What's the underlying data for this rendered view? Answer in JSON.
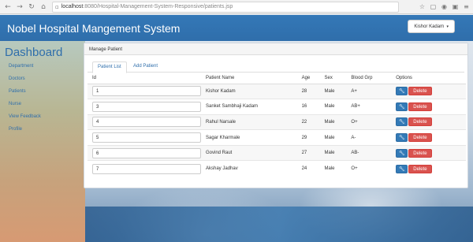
{
  "browser": {
    "url_host": "localhost",
    "url_path": ":8080/Hospital-Management-System-Responsive/patients.jsp"
  },
  "header": {
    "brand": "Nobel Hospital Mangement System",
    "user": "Kishor Kadam"
  },
  "sidebar": {
    "title": "Dashboard",
    "items": [
      {
        "label": "Department"
      },
      {
        "label": "Doctors"
      },
      {
        "label": "Patients"
      },
      {
        "label": "Nurse"
      },
      {
        "label": "View Feedback"
      },
      {
        "label": "Profile"
      }
    ]
  },
  "panel": {
    "heading": "Manage Patient",
    "tabs": [
      {
        "label": "Patient List",
        "active": true
      },
      {
        "label": "Add Patient",
        "active": false
      }
    ],
    "columns": [
      "Id",
      "Patient Name",
      "Age",
      "Sex",
      "Blood Grp",
      "Options"
    ],
    "rows": [
      {
        "id": "1",
        "name": "Kishor Kadam",
        "age": "28",
        "sex": "Male",
        "blood": "A+"
      },
      {
        "id": "3",
        "name": "Sanket Sambhaji Kadam",
        "age": "16",
        "sex": "Male",
        "blood": "AB+"
      },
      {
        "id": "4",
        "name": "Rahul Narsale",
        "age": "22",
        "sex": "Male",
        "blood": "O+"
      },
      {
        "id": "5",
        "name": "Sagar Kharmale",
        "age": "29",
        "sex": "Male",
        "blood": "A-"
      },
      {
        "id": "6",
        "name": "Govind Raut",
        "age": "27",
        "male": "",
        "sex": "Male",
        "blood": "AB-"
      },
      {
        "id": "7",
        "name": "Akshay Jadhav",
        "age": "24",
        "sex": "Male",
        "blood": "O+"
      }
    ],
    "delete_label": "Delete",
    "edit_icon": "wrench-icon"
  }
}
